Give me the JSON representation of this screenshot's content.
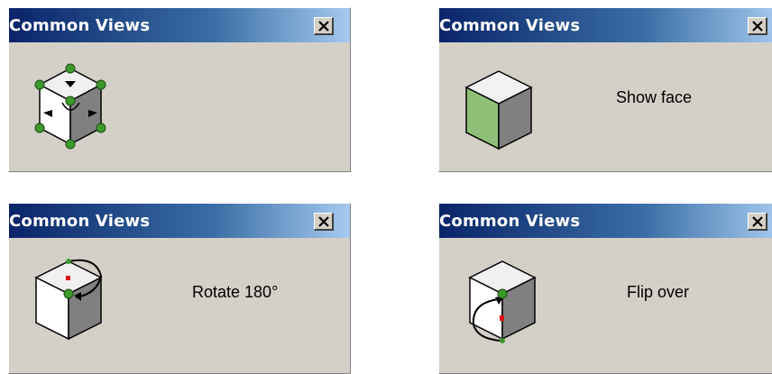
{
  "dialogs": [
    {
      "title": "Common Views",
      "caption": ""
    },
    {
      "title": "Common Views",
      "caption": "Show face"
    },
    {
      "title": "Common Views",
      "caption": "Rotate 180°"
    },
    {
      "title": "Common Views",
      "caption": "Flip over"
    }
  ],
  "icons": {
    "close": "close-icon",
    "cube": "cube-icon"
  },
  "colors": {
    "titlebar_dark": "#0a246a",
    "titlebar_light": "#a6caf0",
    "dialog_face": "#d4d0c8",
    "handle_green": "#3c9a2c",
    "highlight_face": "#8fc078",
    "marker_red": "#e01010"
  }
}
